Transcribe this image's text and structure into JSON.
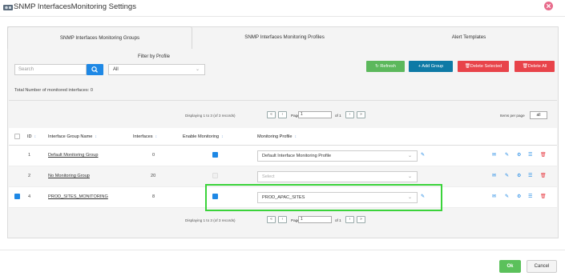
{
  "window": {
    "title": "SNMP InterfacesMonitoring Settings"
  },
  "tabs": [
    {
      "label": "SNMP Interfaces Monitoring Groups",
      "active": true
    },
    {
      "label": "SNMP Interfaces Monitoring Profiles",
      "active": false
    },
    {
      "label": "Alert Templates",
      "active": false
    }
  ],
  "search": {
    "placeholder": "Search"
  },
  "filter": {
    "label": "Filter by Profile",
    "value": "All"
  },
  "buttons": {
    "refresh": "Refresh",
    "add_group": "Add Group",
    "delete_selected": "Delete Selected",
    "delete_all": "Delete All"
  },
  "total_text": "Total Number of monitored interfaces: 0",
  "pager": {
    "displaying": "Displaying 1 to 3 (of 3 records)",
    "page_label": "Page",
    "page_value": "1",
    "of_label": "of 1",
    "items_per_page_label": "Items per page",
    "items_per_page_value": "all"
  },
  "table": {
    "columns": [
      "ID",
      "Interface Group Name",
      "Interfaces",
      "Enable Monitoring",
      "Monitoring Profile"
    ],
    "rows": [
      {
        "id": "1",
        "name": "Default Monitoring Group",
        "interfaces": "0",
        "enabled": true,
        "profile": "Default Interface Monitoring Profile",
        "selected": false
      },
      {
        "id": "2",
        "name": "No Monitoring Group",
        "interfaces": "20",
        "enabled": false,
        "profile": "Select",
        "selected": false
      },
      {
        "id": "4",
        "name": "PROD_SITES_MONITORING",
        "interfaces": "8",
        "enabled": true,
        "profile": "PROD_APAC_SITES",
        "selected": true
      }
    ]
  },
  "footer": {
    "ok": "Ok",
    "cancel": "Cancel"
  },
  "colors": {
    "accent": "#1e88e5",
    "refresh": "#5cb85c",
    "add": "#0e7aa6",
    "delete": "#e8434a",
    "highlight": "#3bd33b"
  }
}
